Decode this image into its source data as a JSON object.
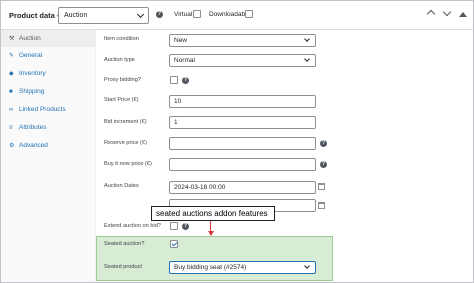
{
  "header": {
    "title": "Product data —",
    "product_type": "Auction",
    "virtual_label": "Virtual:",
    "downloadable_label": "Downloadable:"
  },
  "sidebar": {
    "items": [
      {
        "label": "Auction",
        "icon": "gavel-icon"
      },
      {
        "label": "General",
        "icon": "wrench-icon"
      },
      {
        "label": "Inventory",
        "icon": "tag-icon"
      },
      {
        "label": "Shipping",
        "icon": "truck-icon"
      },
      {
        "label": "Linked Products",
        "icon": "link-icon"
      },
      {
        "label": "Attributes",
        "icon": "list-icon"
      },
      {
        "label": "Advanced",
        "icon": "gear-icon"
      }
    ]
  },
  "fields": {
    "item_condition": {
      "label": "Item condition",
      "value": "New"
    },
    "auction_type": {
      "label": "Auction type",
      "value": "Normal"
    },
    "proxy_bidding": {
      "label": "Proxy bidding?"
    },
    "start_price": {
      "label": "Start Price (€)",
      "value": "10"
    },
    "bid_increment": {
      "label": "Bid increment (€)",
      "value": "1"
    },
    "reserve_price": {
      "label": "Reserve price (€)",
      "value": ""
    },
    "buy_it_now_price": {
      "label": "Buy it now price (€)",
      "value": ""
    },
    "auction_dates": {
      "label": "Auction Dates",
      "start_value": "2024-03-18 00:00"
    },
    "extend_auction": {
      "label": "Extend auction on bid?"
    },
    "seated_auction": {
      "label": "Seated auction?"
    },
    "seated_product": {
      "label": "Seated product",
      "value": "Buy bidding seat (#2574)"
    }
  },
  "callout": {
    "text": "seated auctions addon features"
  },
  "colors": {
    "accent": "#2271b1",
    "highlight_bg": "#d7ebd5",
    "arrow": "#d63638"
  }
}
